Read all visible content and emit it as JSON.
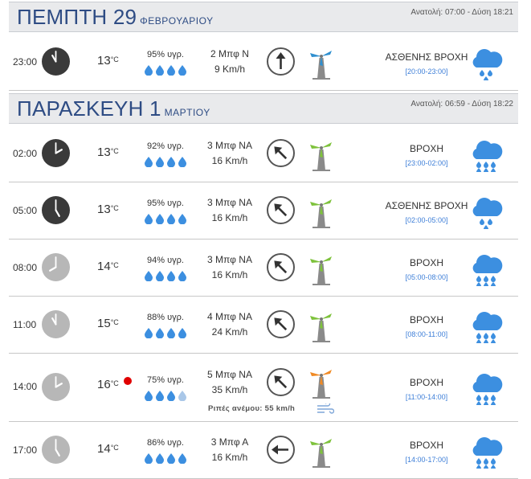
{
  "days": [
    {
      "title": "ΠΕΜΠΤΗ 29",
      "month": "ΦΕΒΡΟΥΑΡΙΟΥ",
      "sun": "Ανατολή: 07:00  - Δύση 18:21",
      "rows": [
        {
          "time": "23:00",
          "temp": "13",
          "unit": "°C",
          "humidity": "95% υγρ.",
          "drops": 4,
          "wind_bf": "2 Μπφ Ν",
          "wind_kmh": "9 Km/h",
          "desc": "ΑΣΘΕΝΗΣ ΒΡΟΧΗ",
          "range": "[20:00-23:00]"
        }
      ]
    },
    {
      "title": "ΠΑΡΑΣΚΕΥΗ 1",
      "month": "ΜΑΡΤΙΟΥ",
      "sun": "Ανατολή: 06:59  - Δύση 18:22",
      "rows": [
        {
          "time": "02:00",
          "temp": "13",
          "unit": "°C",
          "humidity": "92% υγρ.",
          "drops": 4,
          "wind_bf": "3 Μπφ ΝΑ",
          "wind_kmh": "16 Km/h",
          "desc": "ΒΡΟΧΗ",
          "range": "[23:00-02:00]"
        },
        {
          "time": "05:00",
          "temp": "13",
          "unit": "°C",
          "humidity": "95% υγρ.",
          "drops": 4,
          "wind_bf": "3 Μπφ ΝΑ",
          "wind_kmh": "16 Km/h",
          "desc": "ΑΣΘΕΝΗΣ ΒΡΟΧΗ",
          "range": "[02:00-05:00]"
        },
        {
          "time": "08:00",
          "temp": "14",
          "unit": "°C",
          "humidity": "94% υγρ.",
          "drops": 4,
          "wind_bf": "3 Μπφ ΝΑ",
          "wind_kmh": "16 Km/h",
          "desc": "ΒΡΟΧΗ",
          "range": "[05:00-08:00]"
        },
        {
          "time": "11:00",
          "temp": "15",
          "unit": "°C",
          "humidity": "88% υγρ.",
          "drops": 4,
          "wind_bf": "4 Μπφ ΝΑ",
          "wind_kmh": "24 Km/h",
          "desc": "ΒΡΟΧΗ",
          "range": "[08:00-11:00]"
        },
        {
          "time": "14:00",
          "temp": "16",
          "unit": "°C",
          "humidity": "75% υγρ.",
          "drops": 3,
          "wind_bf": "5 Μπφ ΝΑ",
          "wind_kmh": "35 Km/h",
          "gust": "Ριπές ανέμου: 55 km/h",
          "desc": "ΒΡΟΧΗ",
          "range": "[11:00-14:00]"
        },
        {
          "time": "17:00",
          "temp": "14",
          "unit": "°C",
          "humidity": "86% υγρ.",
          "drops": 4,
          "wind_bf": "3 Μπφ Α",
          "wind_kmh": "16 Km/h",
          "desc": "ΒΡΟΧΗ",
          "range": "[14:00-17:00]"
        }
      ]
    }
  ],
  "colors": {
    "accent": "#2e4c84",
    "link": "#3e7fd8",
    "drop": "#3c8fe0",
    "alert": "#e00000",
    "turbine_low": "#2f8fcf",
    "turbine_mid": "#7ec23c",
    "turbine_high": "#f08a24"
  },
  "icons": {
    "clock": "clock-icon",
    "arrow": "wind-direction-icon",
    "turbine": "wind-turbine-icon",
    "cloud": "rain-cloud-icon",
    "drop": "humidity-drop-icon",
    "alert": "alert-dot-icon",
    "gust": "gust-wind-icon"
  }
}
